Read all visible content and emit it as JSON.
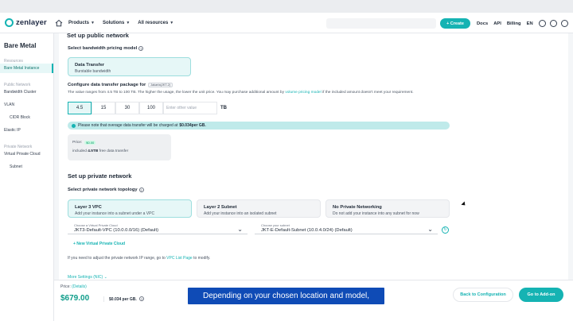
{
  "brand": {
    "name": "zenlayer",
    "accent": "#15b3b3"
  },
  "topnav": {
    "menus": [
      "Products",
      "Solutions",
      "All resources"
    ],
    "create_label": "+ Create",
    "links": [
      "Docs",
      "API",
      "Billing",
      "EN"
    ],
    "icons": [
      "bell-icon",
      "headset-icon",
      "user-icon"
    ]
  },
  "sidebar": {
    "title": "Bare Metal",
    "groups": [
      {
        "label": "Resources",
        "items": [
          "Bare Metal Instance"
        ]
      },
      {
        "label": "Public Network",
        "items": [
          "Bandwidth Cluster",
          "VLAN",
          "CIDR Block",
          "Elastic IP"
        ]
      },
      {
        "label": "Private Network",
        "items": [
          "Virtual Private Cloud",
          "Subnet"
        ]
      }
    ]
  },
  "public": {
    "heading": "Set up public network",
    "model_label": "Select bandwidth pricing model",
    "model_title": "Data Transfer",
    "model_sub": "Burstable bandwidth",
    "package_label": "Configure data transfer package for",
    "package_tag": "Jakarta(JKT-2)",
    "desc_pre": "The value ranges from 4.5 TB to 100 TB. The higher the usage, the lower the unit price. You may purchase additional amount by",
    "desc_link": "volume pricing model",
    "desc_post": "if the included amount doesn't meet your requirement.",
    "packages": [
      "4.5",
      "15",
      "30",
      "100"
    ],
    "other_placeholder": "Enter other value",
    "unit": "TB",
    "note_pre": "Please note that overage data transfer will be charged at",
    "note_price": "$0.034per GB.",
    "price_label": "Price:",
    "price_badge": "$0.00",
    "included_pre": "included",
    "included_amount": "4.5TB",
    "included_post": "free data transfer"
  },
  "private": {
    "heading": "Set up private network",
    "topology_label": "Select private network topology",
    "options": [
      {
        "title": "Layer 3 VPC",
        "sub": "Add your instance into a subnet under a VPC"
      },
      {
        "title": "Layer 2 Subnet",
        "sub": "Add your instance into an isolated subnet"
      },
      {
        "title": "No Private Networking",
        "sub": "Do not add your instance into any subnet for now"
      }
    ],
    "vpc_select_label": "Choose a Virtual Private Cloud",
    "vpc_select_value": "JKT3-Default-VPC (10.0.0.0/16) (Default)",
    "subnet_select_label": "Choose your subnet",
    "subnet_select_value": "JKT-E-Default-Subnet (10.0.4.0/24) (Default)",
    "add_vpc": "+ New Virtual Private Cloud",
    "adjust_pre": "If you need to adjust the private network IP range, go to",
    "adjust_link": "VPC List Page",
    "adjust_post": "to modify.",
    "more_settings": "More Settings (NIC)"
  },
  "footer": {
    "price_label": "Price:",
    "details_link": "(Details)",
    "total": "$679.00",
    "per_gb": "$0.034 per GB.",
    "back_button": "Back to Configuration",
    "next_button": "Go to Add-on"
  },
  "caption": "Depending on your chosen location and model,"
}
